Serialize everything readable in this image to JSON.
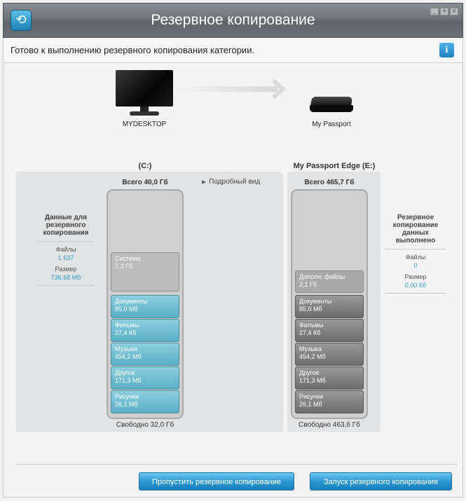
{
  "window": {
    "title": "Резервное копирование",
    "status_text": "Готово к выполнению резервного копирования категории.",
    "info_button": "i",
    "controls": [
      "_",
      "+",
      "x"
    ]
  },
  "devices": {
    "source_label": "MYDESKTOP",
    "target_label": "My Passport"
  },
  "source_drive": {
    "title": "(C:)",
    "total": "Всего 40,0 Гб",
    "free": "Свободно 32,0 Гб",
    "segments": [
      {
        "name": "Система",
        "size": "7,3 Гб"
      },
      {
        "name": "Документы",
        "size": "85,0 Мб"
      },
      {
        "name": "Фильмы",
        "size": "27,4 Кб"
      },
      {
        "name": "Музыка",
        "size": "454,2 Мб"
      },
      {
        "name": "Другое",
        "size": "171,3 Мб"
      },
      {
        "name": "Рисунки",
        "size": "26,1 Мб"
      }
    ]
  },
  "target_drive": {
    "title": "My Passport Edge (E:)",
    "total": "Всего 465,7 Гб",
    "free": "Свободно 463,6 Гб",
    "segments": [
      {
        "name": "Дополн. файлы",
        "size": "2,1 Гб"
      },
      {
        "name": "Документы",
        "size": "85,0 Мб"
      },
      {
        "name": "Фильмы",
        "size": "27,4 Кб"
      },
      {
        "name": "Музыка",
        "size": "454,2 Мб"
      },
      {
        "name": "Другое",
        "size": "171,3 Мб"
      },
      {
        "name": "Рисунки",
        "size": "26,1 Мб"
      }
    ]
  },
  "detail_view": "Подробный вид",
  "left_info": {
    "heading": "Данные для резервного копирования",
    "files_label": "Файлы",
    "files_value": "1 637",
    "size_label": "Размер",
    "size_value": "736,68 Мб"
  },
  "right_info": {
    "heading": "Резервное копирование данных выполнено",
    "files_label": "Файлы",
    "files_value": "0",
    "size_label": "Размер",
    "size_value": "0,00 Кб"
  },
  "buttons": {
    "skip": "Пропустить резервное копирование",
    "start": "Запуск резервного копирования"
  },
  "colors": {
    "accent": "#2a9bd4",
    "button": "#2994cf",
    "segment_blue": "#72bfd4"
  }
}
